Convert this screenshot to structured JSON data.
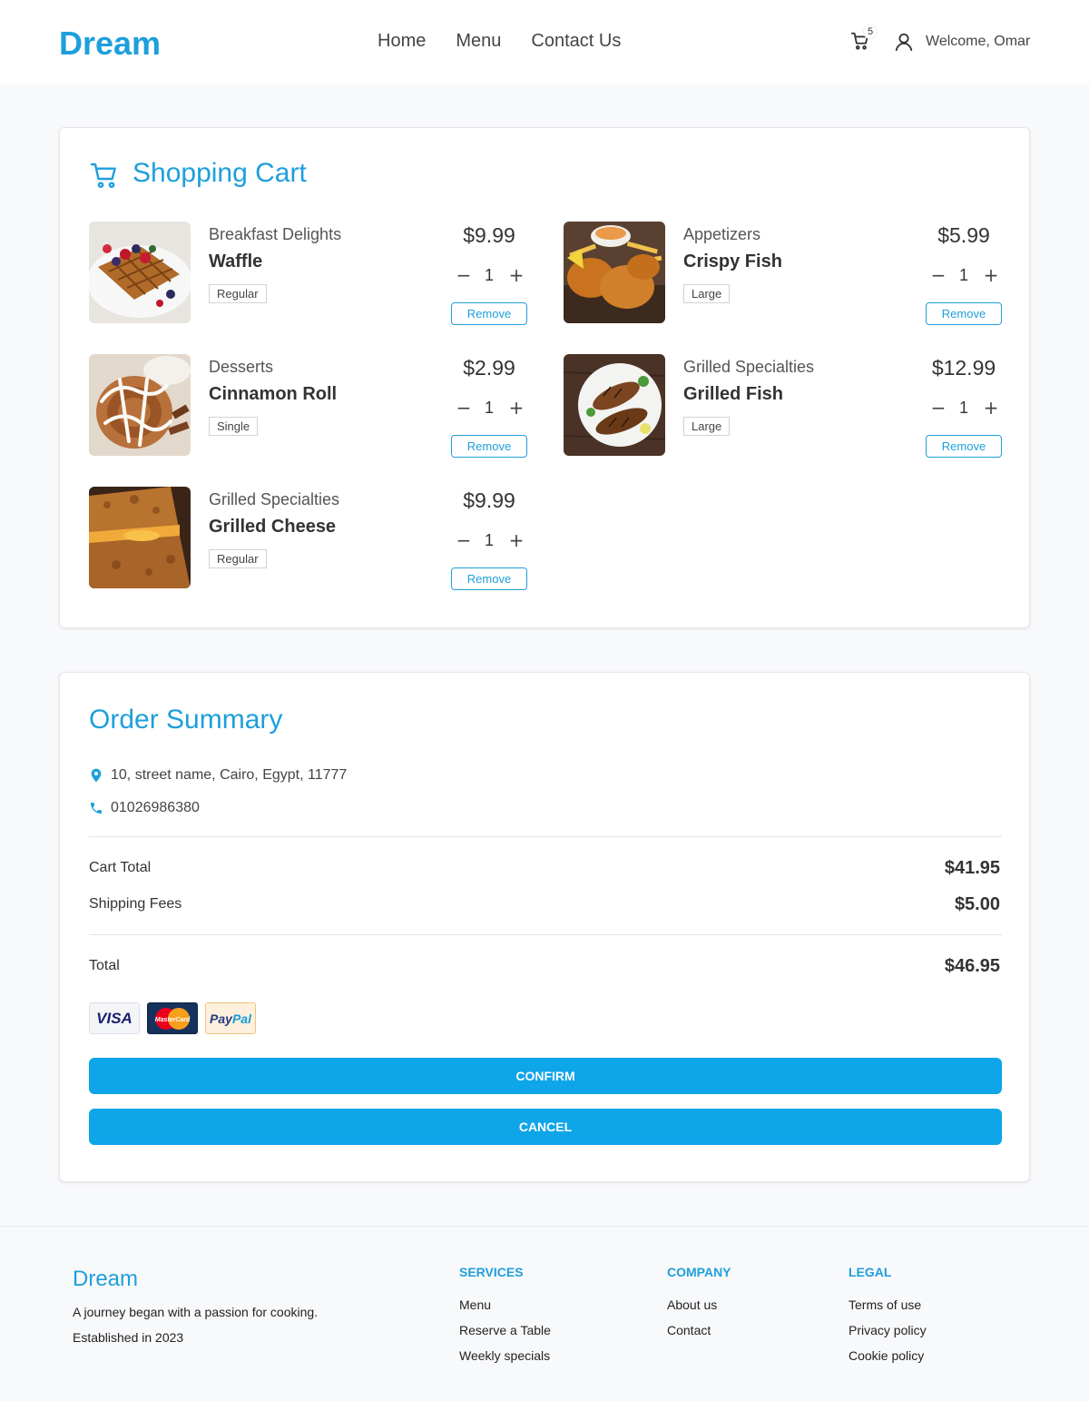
{
  "header": {
    "brand": "Dream",
    "nav": [
      "Home",
      "Menu",
      "Contact Us"
    ],
    "cart_count": "5",
    "welcome": "Welcome, Omar"
  },
  "cart": {
    "title": "Shopping Cart",
    "remove_label": "Remove",
    "items": [
      {
        "category": "Breakfast Delights",
        "name": "Waffle",
        "size": "Regular",
        "price": "$9.99",
        "qty": "1",
        "image": "waffle-photo"
      },
      {
        "category": "Appetizers",
        "name": "Crispy Fish",
        "size": "Large",
        "price": "$5.99",
        "qty": "1",
        "image": "crispy-fish-photo"
      },
      {
        "category": "Desserts",
        "name": "Cinnamon Roll",
        "size": "Single",
        "price": "$2.99",
        "qty": "1",
        "image": "cinnamon-roll-photo"
      },
      {
        "category": "Grilled Specialties",
        "name": "Grilled Fish",
        "size": "Large",
        "price": "$12.99",
        "qty": "1",
        "image": "grilled-fish-photo"
      },
      {
        "category": "Grilled Specialties",
        "name": "Grilled Cheese",
        "size": "Regular",
        "price": "$9.99",
        "qty": "1",
        "image": "grilled-cheese-photo"
      }
    ]
  },
  "summary": {
    "title": "Order Summary",
    "address": "10, street name, Cairo, Egypt, 11777",
    "phone": "01026986380",
    "cart_total_label": "Cart Total",
    "cart_total": "$41.95",
    "shipping_label": "Shipping Fees",
    "shipping": "$5.00",
    "total_label": "Total",
    "total": "$46.95",
    "payments": [
      "VISA",
      "MasterCard",
      "PayPal"
    ],
    "confirm_label": "CONFIRM",
    "cancel_label": "CANCEL"
  },
  "footer": {
    "brand": "Dream",
    "tagline": "A journey began with a passion for cooking.",
    "established": "Established in 2023",
    "columns": [
      {
        "heading": "SERVICES",
        "links": [
          "Menu",
          "Reserve a Table",
          "Weekly specials"
        ]
      },
      {
        "heading": "COMPANY",
        "links": [
          "About us",
          "Contact"
        ]
      },
      {
        "heading": "LEGAL",
        "links": [
          "Terms of use",
          "Privacy policy",
          "Cookie policy"
        ]
      }
    ]
  },
  "colors": {
    "accent": "#1e9fdc",
    "button": "#0ea5e9"
  }
}
